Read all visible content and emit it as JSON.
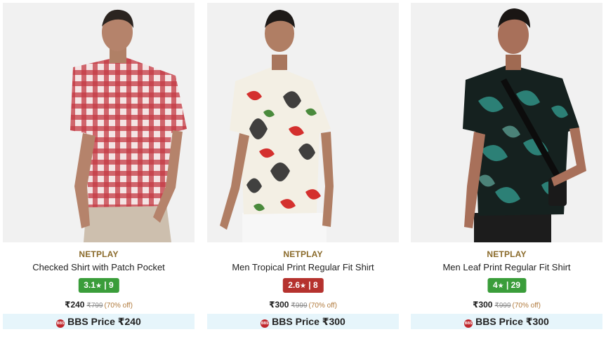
{
  "products": [
    {
      "brand": "NETPLAY",
      "name": "Checked Shirt with Patch Pocket",
      "rating": "3.1",
      "rating_count": "9",
      "rating_color": "#3a9d3a",
      "price": "₹240",
      "mrp": "₹799",
      "discount": "(70% off)",
      "bbs_label": "BBS Price ₹240",
      "bbs_logo": "BBS"
    },
    {
      "brand": "NETPLAY",
      "name": "Men Tropical Print Regular Fit Shirt",
      "rating": "2.6",
      "rating_count": "8",
      "rating_color": "#b5322e",
      "price": "₹300",
      "mrp": "₹999",
      "discount": "(70% off)",
      "bbs_label": "BBS Price ₹300",
      "bbs_logo": "BBS"
    },
    {
      "brand": "NETPLAY",
      "name": "Men Leaf Print Regular Fit Shirt",
      "rating": "4",
      "rating_count": "29",
      "rating_color": "#3a9d3a",
      "price": "₹300",
      "mrp": "₹999",
      "discount": "(70% off)",
      "bbs_label": "BBS Price ₹300",
      "bbs_logo": "BBS"
    }
  ],
  "rating_separator": "|",
  "star_icon": "star-icon"
}
